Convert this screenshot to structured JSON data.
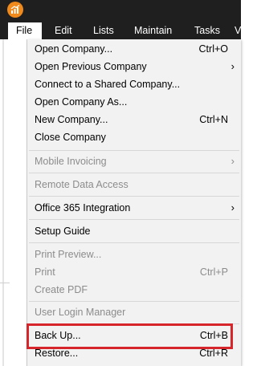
{
  "app": {
    "logo_icon": "quickbooks-logo-icon",
    "accent_color": "#f08a1c"
  },
  "menubar": {
    "items": [
      {
        "label": "File"
      },
      {
        "label": "Edit"
      },
      {
        "label": "Lists"
      },
      {
        "label": "Maintain"
      },
      {
        "label": "Tasks"
      },
      {
        "label": "V"
      }
    ]
  },
  "file_menu": {
    "items": [
      {
        "label": "Open Company...",
        "shortcut": "Ctrl+O",
        "enabled": true
      },
      {
        "label": "Open Previous Company",
        "shortcut": "",
        "submenu": true,
        "enabled": true
      },
      {
        "label": "Connect to a Shared Company...",
        "shortcut": "",
        "enabled": true
      },
      {
        "label": "Open Company As...",
        "shortcut": "",
        "enabled": true
      },
      {
        "label": "New Company...",
        "shortcut": "Ctrl+N",
        "enabled": true
      },
      {
        "label": "Close Company",
        "shortcut": "",
        "enabled": true
      },
      {
        "label": "Mobile Invoicing",
        "shortcut": "",
        "submenu": true,
        "enabled": false
      },
      {
        "label": "Remote Data Access",
        "shortcut": "",
        "enabled": false
      },
      {
        "label": "Office 365 Integration",
        "shortcut": "",
        "submenu": true,
        "enabled": true
      },
      {
        "label": "Setup Guide",
        "shortcut": "",
        "enabled": true
      },
      {
        "label": "Print Preview...",
        "shortcut": "",
        "enabled": false
      },
      {
        "label": "Print",
        "shortcut": "Ctrl+P",
        "enabled": false
      },
      {
        "label": "Create PDF",
        "shortcut": "",
        "enabled": false
      },
      {
        "label": "User Login Manager",
        "shortcut": "",
        "enabled": false
      },
      {
        "label": "Back Up...",
        "shortcut": "Ctrl+B",
        "enabled": true,
        "highlighted": true
      },
      {
        "label": "Restore...",
        "shortcut": "Ctrl+R",
        "enabled": true
      }
    ],
    "submenu_arrow": "›"
  },
  "highlight_color": "#d6262b"
}
